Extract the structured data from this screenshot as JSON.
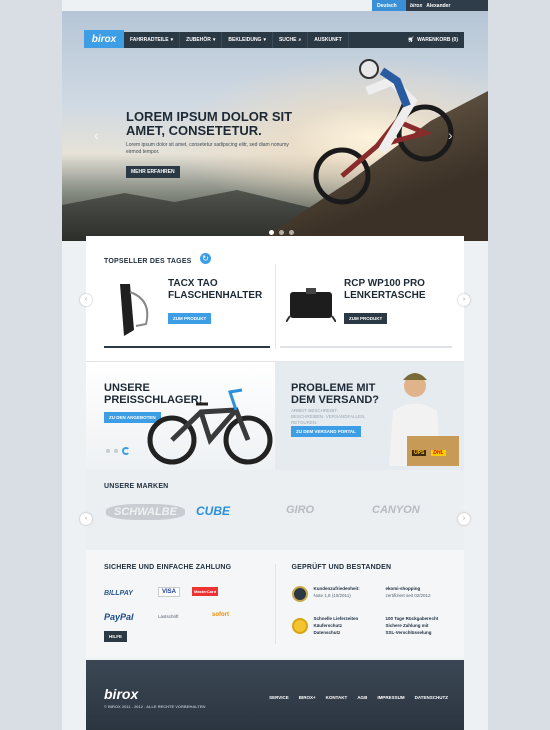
{
  "topbar": {
    "language": "Deutsch",
    "brand": "birox",
    "user": "Alexander"
  },
  "nav": {
    "logo": "birox",
    "items": [
      "FAHRRADTEILE",
      "ZUBEHÖR",
      "BEKLEIDUNG",
      "SUCHE",
      "AUSKUNFT"
    ],
    "cart": "WARENKORB (0)"
  },
  "hero": {
    "title": "LOREM IPSUM DOLOR SIT AMET, CONSETETUR.",
    "text": "Lorem ipsum dolor sit amet, consetetur sadipscing elitr, sed diam nonumy eirmod tempor.",
    "button": "MEHR ERFAHREN"
  },
  "topseller": {
    "title": "TOPSELLER DES TAGES",
    "products": [
      {
        "name": "TACX TAO FLASCHENHALTER",
        "button": "ZUM PRODUKT"
      },
      {
        "name": "RCP WP100 PRO LENKERTASCHE",
        "button": "ZUM PRODUKT"
      }
    ]
  },
  "promo": {
    "left": {
      "title": "UNSERE PREISSCHLAGER!",
      "button": "ZU DEN ANGEBOTEN"
    },
    "right": {
      "title": "PROBLEME MIT DEM VERSAND?",
      "text": "ARBEIT BESCHREIBT. BESCHREIBEN. VERSANDFALLEN, RETOUREN.",
      "button": "ZU DEM VERSAND PORTAL",
      "carriers": [
        "UPS",
        "DHL"
      ]
    }
  },
  "brands": {
    "title": "UNSERE MARKEN",
    "items": [
      "SCHWALBE",
      "CUBE",
      "GIRO",
      "CANYON"
    ]
  },
  "payment": {
    "title": "SICHERE UND EINFACHE ZAHLUNG",
    "methods": [
      "BILLPAY",
      "VISA",
      "MasterCard",
      "PayPal",
      "Lastschrift",
      "sofort"
    ],
    "help": "HILFE"
  },
  "trust": {
    "title": "GEPRÜFT UND BESTANDEN",
    "rating_label": "Kundenzufriedenheit:",
    "rating_value": "Note 1,8 (10/2011)",
    "ekomi": "ekomi-shopping",
    "ekomi_date": "zertifiziert seit 02/2012",
    "features": [
      "Schnelle Lieferzeiten",
      "Käuferschutz",
      "Datenschutz",
      "100 Tage Rückgaberecht",
      "Sichere Zahlung mit",
      "SSL-Verschlüsselung"
    ]
  },
  "footer": {
    "logo": "birox",
    "copyright": "© BIROX 2011 - 2012 . ALLE RECHTE VORBEHALTEN",
    "links": [
      "SERVICE",
      "BIROX+",
      "KONTAKT",
      "AGB",
      "IMPRESSUM",
      "DATENSCHUTZ"
    ]
  },
  "colors": {
    "accent": "#3d9ee5",
    "dark": "#2b3945"
  }
}
